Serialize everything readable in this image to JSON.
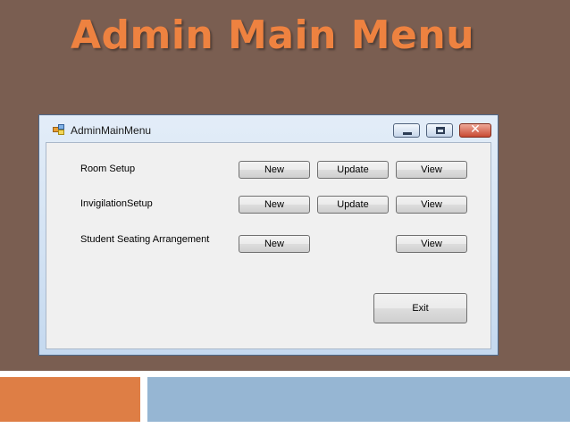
{
  "slide": {
    "title": "Admin Main Menu"
  },
  "window": {
    "title": "AdminMainMenu",
    "controls": {
      "close_glyph": "✕"
    },
    "icons": {
      "app": "app-form-icon",
      "minimize": "minimize-icon",
      "maximize": "maximize-icon",
      "close": "close-icon"
    }
  },
  "rows": [
    {
      "label": "Room Setup",
      "new_label": "New",
      "update_label": "Update",
      "view_label": "View"
    },
    {
      "label": "InvigilationSetup",
      "new_label": "New",
      "update_label": "Update",
      "view_label": "View"
    },
    {
      "label": "Student Seating Arrangement",
      "new_label": "New",
      "view_label": "View"
    }
  ],
  "exit_label": "Exit",
  "colors": {
    "slide_background": "#7a5e51",
    "title_text": "#ee8240",
    "band_orange": "#de7e45",
    "band_blue": "#96b6d3",
    "client_background": "#f0f0f0"
  }
}
